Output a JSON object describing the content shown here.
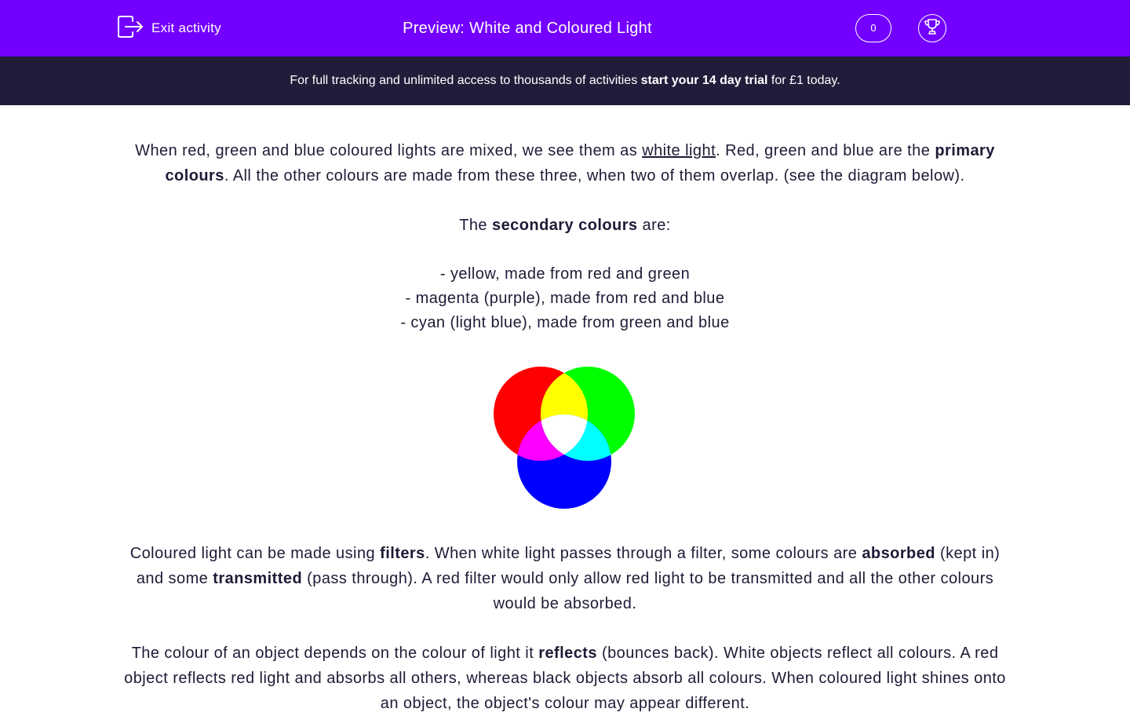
{
  "header": {
    "exit_label": "Exit activity",
    "title": "Preview: White and Coloured Light",
    "score": "0"
  },
  "banner": {
    "text_before": "For full tracking and unlimited access to thousands of activities ",
    "cta": "start your 14 day trial",
    "text_after": " for £1 today."
  },
  "content": {
    "p1": {
      "a": "When red, green and blue coloured lights are mixed, we see them as ",
      "link": "white light",
      "b": ". Red, green and blue are the ",
      "bold": "primary colours",
      "c": ". All the other colours are made from these three, when two of them overlap. (see the diagram below)."
    },
    "p2": {
      "a": "The ",
      "bold": "secondary colours",
      "b": " are:"
    },
    "list": [
      "- yellow, made from red and green",
      "- magenta (purple), made from red and blue",
      "- cyan (light blue), made from green and blue"
    ],
    "p3": {
      "a": "Coloured light can be made using ",
      "bold1": "filters",
      "b": ". When white light passes through a filter, some colours are ",
      "bold2": "absorbed",
      "c": " (kept in) and some ",
      "bold3": "transmitted",
      "d": " (pass through). A red filter would only allow red light to be transmitted and all the other colours would be absorbed."
    },
    "p4": {
      "a": "The colour of an object depends on the colour of light it ",
      "bold": "reflects",
      "b": " (bounces back). White objects reflect all colours. A red object reflects red light and absorbs all others, whereas black objects absorb all colours. When coloured light shines onto an object, the object's colour may appear different."
    }
  },
  "colors": {
    "header_bg": "#7300ff",
    "banner_bg": "#221c3a",
    "text": "#1f1a36",
    "red": "#ff0000",
    "green": "#00ff00",
    "blue": "#0000ff",
    "yellow": "#ffff00",
    "magenta": "#ff00ff",
    "cyan": "#00ffff",
    "white": "#ffffff"
  },
  "icons": {
    "exit": "exit-door-arrow-icon",
    "trophy": "trophy-icon"
  }
}
